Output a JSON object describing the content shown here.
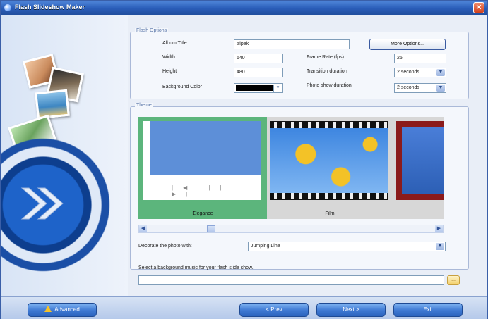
{
  "window": {
    "title": "Flash Slideshow Maker",
    "close_symbol": "✕"
  },
  "flash_options": {
    "group_label": "Flash Options",
    "album_title_label": "Album Title",
    "album_title_value": "tripek",
    "more_options_label": "More Options...",
    "width_label": "Width",
    "width_value": "640",
    "height_label": "Height",
    "height_value": "480",
    "bg_color_label": "Background Color",
    "bg_color_value": "#000000",
    "frame_rate_label": "Frame Rate (fps)",
    "frame_rate_value": "25",
    "transition_label": "Transition duration",
    "transition_value": "2 seconds",
    "photo_show_label": "Photo show duration",
    "photo_show_value": "2 seconds"
  },
  "theme": {
    "group_label": "Theme",
    "cards": [
      {
        "caption": "Elegance",
        "selected": true
      },
      {
        "caption": "Film",
        "selected": false
      },
      {
        "caption": "",
        "selected": false
      }
    ],
    "elegance_controls": "|◀ || ▶|",
    "decorate_label": "Decorate the photo with:",
    "decorate_value": "Jumping Line",
    "music_label": "Select a background music for your flash slide show.",
    "music_value": "",
    "browse_label": "..."
  },
  "bottom": {
    "advanced_label": "Advanced",
    "prev_label": "< Prev",
    "next_label": "Next >",
    "exit_label": "Exit"
  },
  "colors": {
    "accent": "#2c64be",
    "selected_theme": "#5cb57c",
    "title_bar": "#2a5db8"
  }
}
